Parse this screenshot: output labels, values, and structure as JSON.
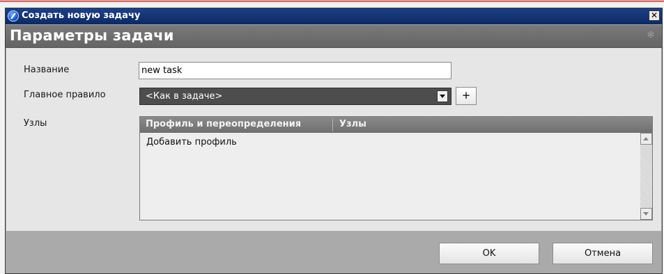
{
  "window": {
    "title": "Создать новую задачу",
    "close_symbol": "✕"
  },
  "header": {
    "title": "Параметры задачи",
    "gear_symbol": "✻"
  },
  "form": {
    "name_label": "Название",
    "name_value": "new task",
    "main_rule_label": "Главное правило",
    "main_rule_value": "<Как в задаче>",
    "add_button_label": "+",
    "nodes_label": "Узлы"
  },
  "grid": {
    "columns": [
      "Профиль и переопределения",
      "Узлы"
    ],
    "add_row_text": "Добавить профиль"
  },
  "footer": {
    "ok_label": "OK",
    "cancel_label": "Отмена"
  },
  "colors": {
    "titlebar": "#123373",
    "section_header": "#6e6e6e",
    "combo_background": "#4d4d4d"
  }
}
